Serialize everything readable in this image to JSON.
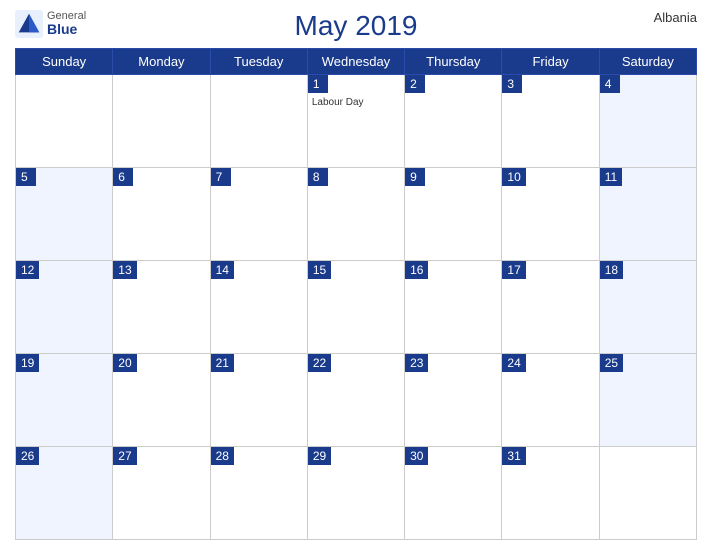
{
  "header": {
    "title": "May 2019",
    "country": "Albania",
    "logo": {
      "general": "General",
      "blue": "Blue"
    }
  },
  "weekdays": [
    "Sunday",
    "Monday",
    "Tuesday",
    "Wednesday",
    "Thursday",
    "Friday",
    "Saturday"
  ],
  "weeks": [
    [
      {
        "day": "",
        "empty": true
      },
      {
        "day": "",
        "empty": true
      },
      {
        "day": "",
        "empty": true
      },
      {
        "day": "1",
        "event": "Labour Day"
      },
      {
        "day": "2"
      },
      {
        "day": "3"
      },
      {
        "day": "4"
      }
    ],
    [
      {
        "day": "5"
      },
      {
        "day": "6"
      },
      {
        "day": "7"
      },
      {
        "day": "8"
      },
      {
        "day": "9"
      },
      {
        "day": "10"
      },
      {
        "day": "11"
      }
    ],
    [
      {
        "day": "12"
      },
      {
        "day": "13"
      },
      {
        "day": "14"
      },
      {
        "day": "15"
      },
      {
        "day": "16"
      },
      {
        "day": "17"
      },
      {
        "day": "18"
      }
    ],
    [
      {
        "day": "19"
      },
      {
        "day": "20"
      },
      {
        "day": "21"
      },
      {
        "day": "22"
      },
      {
        "day": "23"
      },
      {
        "day": "24"
      },
      {
        "day": "25"
      }
    ],
    [
      {
        "day": "26"
      },
      {
        "day": "27"
      },
      {
        "day": "28"
      },
      {
        "day": "29"
      },
      {
        "day": "30"
      },
      {
        "day": "31"
      },
      {
        "day": "",
        "empty": true
      }
    ]
  ],
  "colors": {
    "header_bg": "#1a3a8c",
    "header_text": "#ffffff",
    "day_number_bg": "#1a3a8c",
    "day_number_text": "#ffffff",
    "title_color": "#1a3a8c"
  }
}
